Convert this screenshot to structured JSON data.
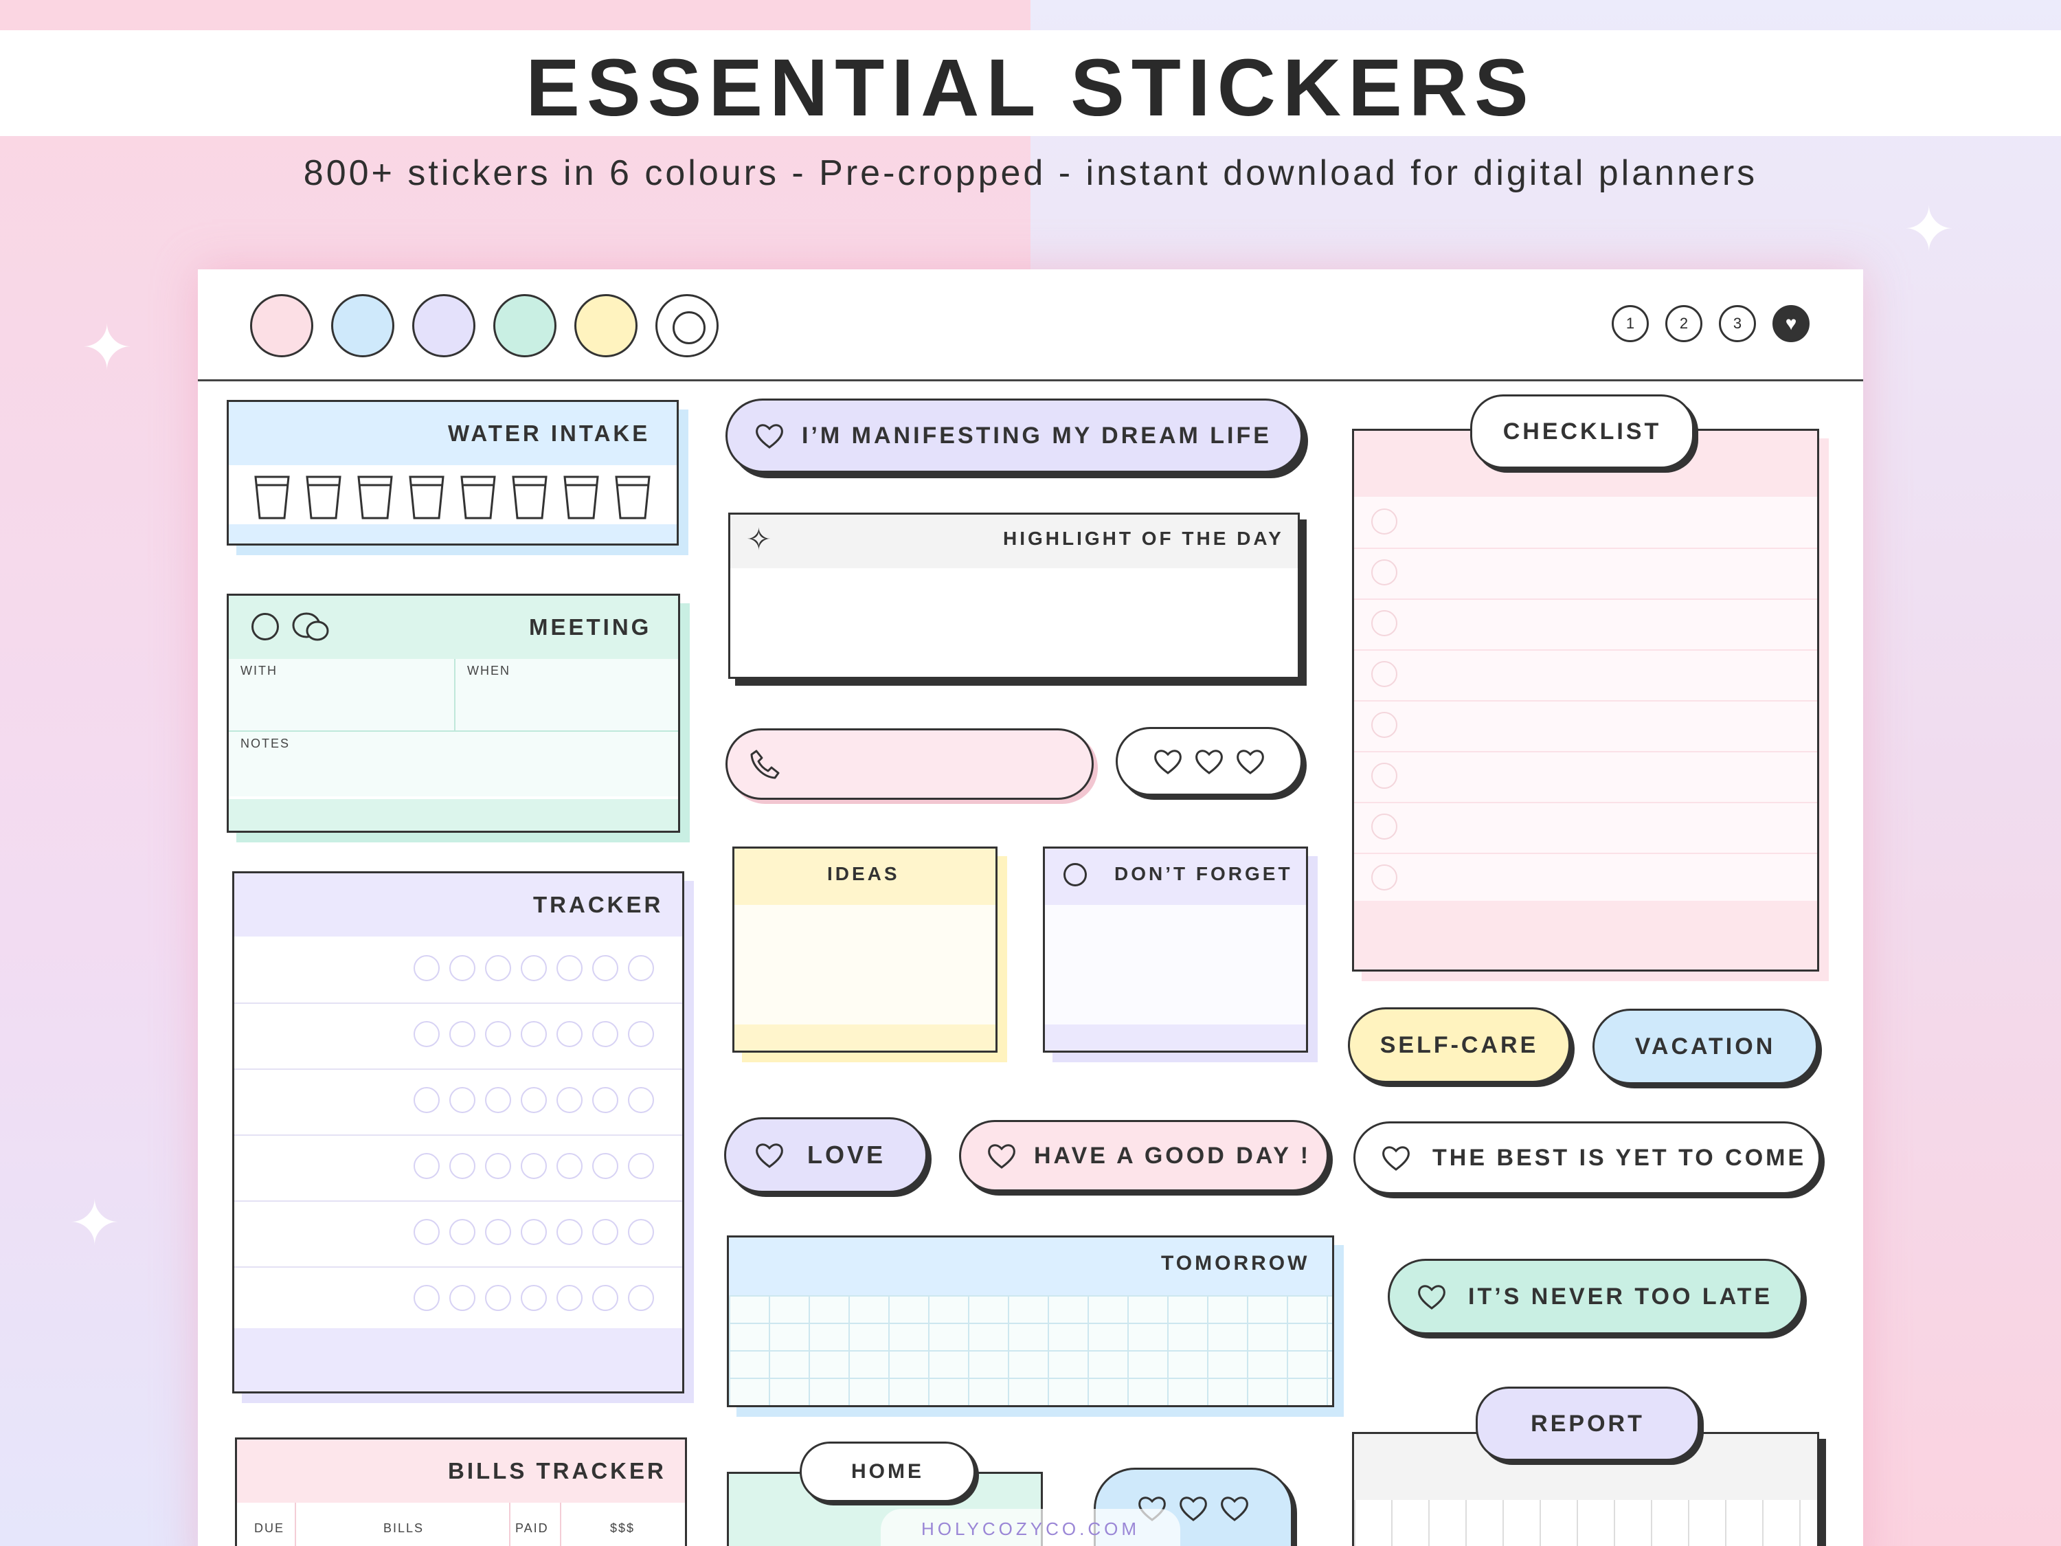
{
  "header": {
    "title": "ESSENTIAL STICKERS",
    "subtitle": "800+ stickers in 6 colours - Pre-cropped - instant download for digital planners"
  },
  "colors": {
    "pink": "#fcdfe5",
    "blue": "#cfe9fb",
    "lavender": "#e4e1fb",
    "mint": "#c9efe3",
    "yellow": "#fff3bf",
    "white": "#ffffff",
    "ink": "#333333"
  },
  "swatches": [
    "pink",
    "blue",
    "lavender",
    "mint",
    "yellow",
    "white"
  ],
  "pages": [
    "1",
    "2",
    "3",
    "♥"
  ],
  "stickers": {
    "water_intake": "WATER INTAKE",
    "meeting": "MEETING",
    "meeting_with": "WITH",
    "meeting_when": "WHEN",
    "meeting_notes": "NOTES",
    "tracker": "TRACKER",
    "bills_tracker": "BILLS TRACKER",
    "bills_due": "DUE",
    "bills_bills": "BILLS",
    "bills_paid": "PAID",
    "bills_amount": "$$$",
    "manifesting": "I’M MANIFESTING MY DREAM LIFE",
    "highlight": "HIGHLIGHT OF THE DAY",
    "ideas": "IDEAS",
    "dont_forget": "DON’T FORGET",
    "love": "LOVE",
    "good_day": "HAVE A GOOD DAY !",
    "tomorrow": "TOMORROW",
    "home": "HOME",
    "checklist": "CHECKLIST",
    "self_care": "SELF-CARE",
    "vacation": "VACATION",
    "best_yet": "THE BEST IS YET TO COME",
    "never_late": "IT’S NEVER TOO LATE",
    "report": "REPORT"
  },
  "footer": "HOLYCOZYCO.COM",
  "icons": [
    "sparkle-icon",
    "heart-icon",
    "phone-icon",
    "chat-bubbles-icon",
    "cup-icon",
    "circle-icon"
  ]
}
